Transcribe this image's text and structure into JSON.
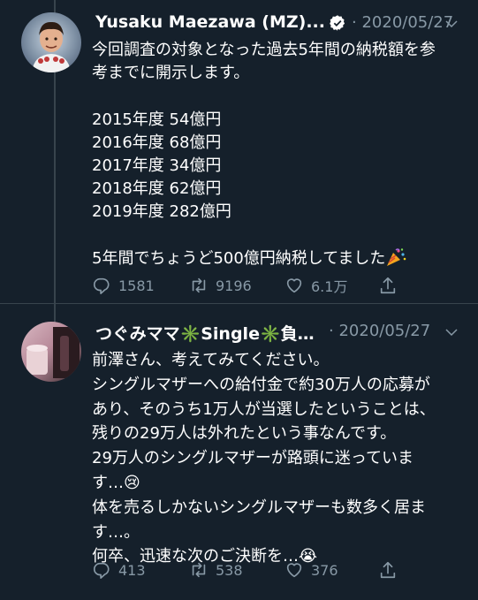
{
  "tweets": [
    {
      "author_name": "Yusaku Maezawa (MZ)...",
      "verified": true,
      "date_prefix": "·",
      "date": "2020/05/27",
      "body": "今回調査の対象となった過去5年間の納税額を参\n考までに開示します。\n\n2015年度 54億円\n2016年度 68億円\n2017年度 34億円\n2018年度 62億円\n2019年度 282億円\n\n5年間でちょうど500億円納税してました",
      "body_emoji": "party-popper",
      "replies": "1581",
      "retweets": "9196",
      "likes": "6.1万"
    },
    {
      "author_name": "つぐみママ✳️Single✳️負…",
      "date_prefix": "·",
      "date": "2020/05/27",
      "body": "前澤さん、考えてみてください。\nシングルマザーへの給付金で約30万人の応募が\nあり、そのうち1万人が当選したということは、\n残りの29万人は外れたという事なんです。\n29万人のシングルマザーが路頭に迷っていま\nす…😢\n体を売るしかないシングルマザーも数多く居ま\nす…。\n何卒、迅速な次のご決断を…😭",
      "replies": "413",
      "retweets": "538",
      "likes": "376"
    }
  ],
  "colors": {
    "background": "#15202b",
    "text": "#ffffff",
    "muted": "#8899a6",
    "divider": "#38444d",
    "verified": "#ffffff"
  },
  "icons": [
    "reply-icon",
    "retweet-icon",
    "like-icon",
    "share-icon",
    "chevron-down-icon",
    "verified-badge-icon",
    "party-popper-icon"
  ]
}
